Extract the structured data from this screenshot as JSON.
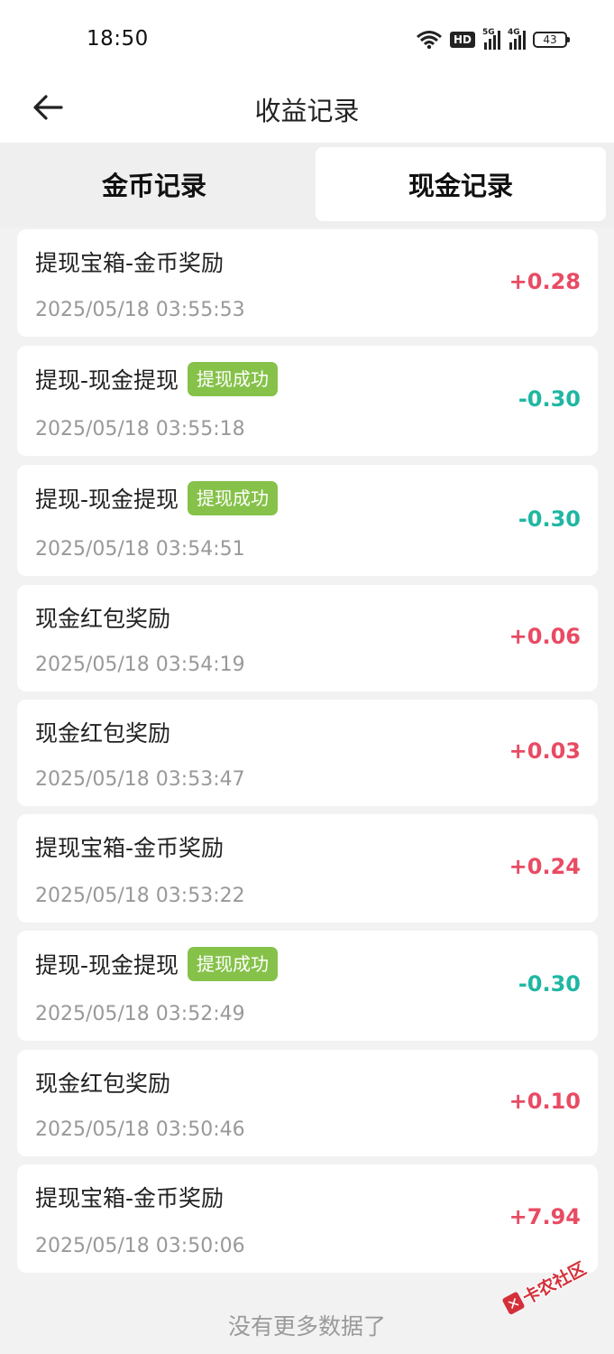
{
  "status_bar": {
    "time": "18:50",
    "network_hd": "HD",
    "signal_1": "5G",
    "signal_2": "4G",
    "battery": "43"
  },
  "header": {
    "title": "收益记录"
  },
  "tabs": [
    {
      "label": "金币记录",
      "active": false
    },
    {
      "label": "现金记录",
      "active": true
    }
  ],
  "records": [
    {
      "title": "提现宝箱-金币奖励",
      "badge": "",
      "time": "2025/05/18 03:55:53",
      "amount": "+0.28",
      "type": "pos"
    },
    {
      "title": "提现-现金提现",
      "badge": "提现成功",
      "time": "2025/05/18 03:55:18",
      "amount": "-0.30",
      "type": "neg"
    },
    {
      "title": "提现-现金提现",
      "badge": "提现成功",
      "time": "2025/05/18 03:54:51",
      "amount": "-0.30",
      "type": "neg"
    },
    {
      "title": "现金红包奖励",
      "badge": "",
      "time": "2025/05/18 03:54:19",
      "amount": "+0.06",
      "type": "pos"
    },
    {
      "title": "现金红包奖励",
      "badge": "",
      "time": "2025/05/18 03:53:47",
      "amount": "+0.03",
      "type": "pos"
    },
    {
      "title": "提现宝箱-金币奖励",
      "badge": "",
      "time": "2025/05/18 03:53:22",
      "amount": "+0.24",
      "type": "pos"
    },
    {
      "title": "提现-现金提现",
      "badge": "提现成功",
      "time": "2025/05/18 03:52:49",
      "amount": "-0.30",
      "type": "neg"
    },
    {
      "title": "现金红包奖励",
      "badge": "",
      "time": "2025/05/18 03:50:46",
      "amount": "+0.10",
      "type": "pos"
    },
    {
      "title": "提现宝箱-金币奖励",
      "badge": "",
      "time": "2025/05/18 03:50:06",
      "amount": "+7.94",
      "type": "pos"
    }
  ],
  "footer": {
    "no_more": "没有更多数据了"
  },
  "watermark": {
    "text": "卡农社区"
  },
  "colors": {
    "positive": "#e84b63",
    "negative": "#1fb7a3",
    "badge": "#86c24a"
  }
}
